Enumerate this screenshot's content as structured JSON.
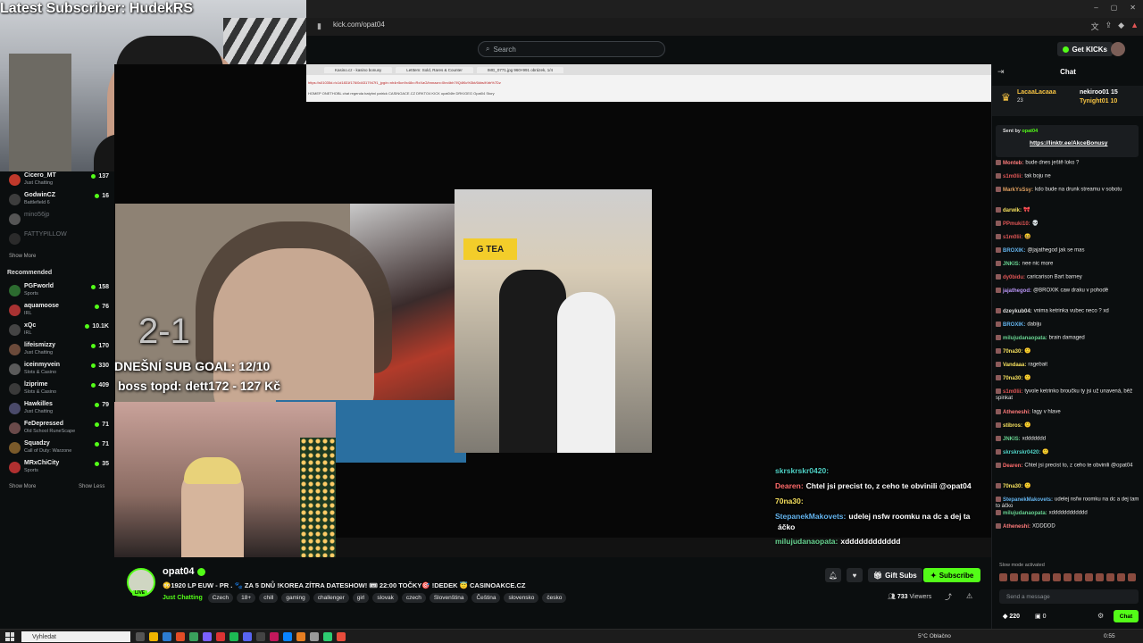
{
  "overlay": {
    "subscriber_banner": "Latest Subscriber: HudekRS",
    "score": "2-1",
    "sub_goal": "DNEŠNÍ SUB GOAL: 12/10",
    "boss_topd": "boss topd:  dett172 - 127 Kč"
  },
  "browser": {
    "url": "kick.com/opat04",
    "window_controls": [
      "–",
      "▢",
      "✕"
    ]
  },
  "header": {
    "search_placeholder": "Search",
    "get_kicks_label": "Get KICKs"
  },
  "inner_browser": {
    "tabs": [
      "Kasino.cz - kasino bonusy",
      "LetItem: Sold, Rares & Counter",
      "IMG_0771.jpg 960×991 obrázek, 1/4"
    ],
    "address": "https://s01035d.r/c1d1831f176/0d4317947f1_jpg/n=nh4rr5cn9x48x=RxXaG/bnnazn=0bn4bh7f/Q4f6c%3kt/6kbs/Kbb%7Dz",
    "bookmarks": "HOMEP  ONETHOBL  chat regenda  batyhni  patrick  CASINOACE.CZ  DRKTO4 KICK  opat04fe  DRK/GEG  Opat04 Story"
  },
  "sidebar": {
    "following": [
      {
        "name": "Cicero_MT",
        "category": "Just Chatting",
        "viewers": "137",
        "avatar_color": "#c0392b",
        "live": true
      },
      {
        "name": "GodwinCZ",
        "category": "Battlefield 6",
        "viewers": "16",
        "avatar_color": "#3d3d3d",
        "live": true
      },
      {
        "name": "mino56jp",
        "category": "",
        "viewers": "",
        "avatar_color": "#555555",
        "live": false
      },
      {
        "name": "FATTYPILLOW",
        "category": "",
        "viewers": "",
        "avatar_color": "#2b2b2b",
        "live": false
      }
    ],
    "show_more_1": "Show More",
    "recommended_label": "Recommended",
    "recommended": [
      {
        "name": "PGFworld",
        "category": "Sports",
        "viewers": "158",
        "avatar_color": "#2c6b2f"
      },
      {
        "name": "aquamoose",
        "category": "IRL",
        "viewers": "76",
        "avatar_color": "#a83232"
      },
      {
        "name": "xQc",
        "category": "IRL",
        "viewers": "10.1K",
        "avatar_color": "#444444"
      },
      {
        "name": "lifeismizzy",
        "category": "Just Chatting",
        "viewers": "170",
        "avatar_color": "#6b4a3a"
      },
      {
        "name": "iceinmyvein",
        "category": "Slots & Casino",
        "viewers": "330",
        "avatar_color": "#5a5a5a"
      },
      {
        "name": "lziprime",
        "category": "Slots & Casino",
        "viewers": "409",
        "avatar_color": "#3a3a3a"
      },
      {
        "name": "Hawkilles",
        "category": "Just Chatting",
        "viewers": "79",
        "avatar_color": "#4a4a6a"
      },
      {
        "name": "FeDepressed",
        "category": "Old School RuneScape",
        "viewers": "71",
        "avatar_color": "#6a4a4a"
      },
      {
        "name": "Squadzy",
        "category": "Call of Duty: Warzone",
        "viewers": "71",
        "avatar_color": "#7a5a2a"
      },
      {
        "name": "MRxChiCity",
        "category": "Sports",
        "viewers": "35",
        "avatar_color": "#b03030"
      }
    ],
    "show_more_2": "Show More",
    "show_less": "Show Less"
  },
  "overlay_chat": [
    {
      "user": "skrskrskr0420:",
      "msg": "",
      "color": "#4fd1c5"
    },
    {
      "user": "Dearen:",
      "msg": "Chtel jsi precist to, z ceho te obvinili @opat04",
      "color": "#ff6b6b"
    },
    {
      "user": "70na30:",
      "msg": "",
      "color": "#f6e05e"
    },
    {
      "user": "StepanekMakovets:",
      "msg": "udelej nsfw roomku na dc a dej ta",
      "color": "#63b3ed"
    },
    {
      "user": "",
      "msg": "áčko",
      "color": "#ffffff"
    },
    {
      "user": "milujudanaopata:",
      "msg": "xdddddddddddd",
      "color": "#68d391"
    }
  ],
  "stream": {
    "streamer": "opat04",
    "live_badge": "LIVE",
    "title": "😳1920 LP EUW - PR . 🐾 ZA 5 DNŮ !KOREA ZÍTRA DATESHOW! 🎟 22:00 TOČKY🎯 !DEDEK 😇 CASINOAKCE.CZ",
    "category": "Just Chatting",
    "tags": [
      "Czech",
      "18+",
      "chill",
      "gaming",
      "challenger",
      "girl",
      "slovak",
      "czech",
      "Slovenština",
      "Čeština",
      "slovensko",
      "česko"
    ],
    "gift_subs_label": "Gift Subs",
    "subscribe_label": "Subscribe",
    "viewers": "733",
    "viewers_label": "Viewers"
  },
  "chat": {
    "title": "Chat",
    "top_gifters": [
      {
        "name": "LacaaLacaaa",
        "count": "23"
      },
      {
        "name": "nekiroo01",
        "count": "15"
      },
      {
        "name": "Tynight01",
        "count": "10"
      }
    ],
    "pinned_by": "Sent by",
    "pinned_user": "opat04",
    "pinned_link": "https://linktr.ee/AkceBonusy",
    "messages": [
      {
        "user": "Monteb:",
        "text": "bude dnes ještě loko ?",
        "color": "#ff7b7b"
      },
      {
        "user": "s1m0lii:",
        "text": "tak boju ne",
        "color": "#e05555"
      },
      {
        "user": "MarkYsSsy:",
        "text": "kdo bude na drunk streamu v sobotu",
        "color": "#e0a060"
      },
      {
        "user": "darwik:",
        "text": "🎀",
        "color": "#f6e05e"
      },
      {
        "user": "PPmuki10:",
        "text": "💀",
        "color": "#e05555"
      },
      {
        "user": "s1m0lii:",
        "text": "😆",
        "color": "#e05555"
      },
      {
        "user": "BROXIK:",
        "text": "@jajathegod jak se mas",
        "color": "#63b3ed"
      },
      {
        "user": "JNKIS:",
        "text": "nee nic more",
        "color": "#68d391"
      },
      {
        "user": "dy0bidu:",
        "text": "caricarison Bart barney",
        "color": "#e05555"
      },
      {
        "user": "jajathegod:",
        "text": "@BROXIK caw draku v pohodě",
        "color": "#b794f4"
      },
      {
        "user": "dzeykub04:",
        "text": "vnima ketrinka vubec neco ? xd",
        "color": "#ddd"
      },
      {
        "user": "BROXIK:",
        "text": "dabiju",
        "color": "#63b3ed"
      },
      {
        "user": "milujudanaopata:",
        "text": "brain damaged",
        "color": "#68d391"
      },
      {
        "user": "70na30:",
        "text": "🙂",
        "color": "#f6e05e"
      },
      {
        "user": "Vandaaa:",
        "text": "ragebait",
        "color": "#f6e05e"
      },
      {
        "user": "70na30:",
        "text": "🙂",
        "color": "#f6e05e"
      },
      {
        "user": "s1m0lii:",
        "text": "tyvole ketrinko broučku ty jsi už unavená, běž spinkat",
        "color": "#e05555"
      },
      {
        "user": "Atheneshi:",
        "text": "lagy v hlave",
        "color": "#ff7b7b"
      },
      {
        "user": "stibros:",
        "text": "🙂",
        "color": "#f6e05e"
      },
      {
        "user": "JNKIS:",
        "text": "xddddddd",
        "color": "#68d391"
      },
      {
        "user": "skrskrskr0420:",
        "text": "🙂",
        "color": "#4fd1c5"
      },
      {
        "user": "Dearen:",
        "text": "Chtel jsi precist to, z ceho te obvinili @opat04",
        "color": "#ff6b6b"
      },
      {
        "user": "70na30:",
        "text": "🙂",
        "color": "#f6e05e"
      },
      {
        "user": "StepanekMakovets:",
        "text": "udelej nsfw roomku na dc a dej tam to áčko",
        "color": "#63b3ed"
      },
      {
        "user": "milujudanaopata:",
        "text": "xdddddddddddd",
        "color": "#68d391"
      },
      {
        "user": "Atheneshi:",
        "text": "XDDDDD",
        "color": "#ff7b7b"
      }
    ],
    "slow_mode": "Slow mode activated",
    "input_placeholder": "Send a message",
    "points": "220",
    "points2": "0",
    "chat_button": "Chat"
  },
  "taskbar": {
    "search": "Vyhledat",
    "weather": "5°C  Oblačno",
    "time": "0:55"
  }
}
